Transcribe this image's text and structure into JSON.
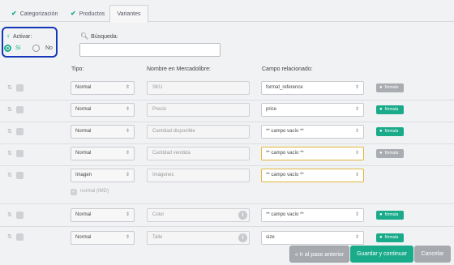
{
  "tabs": [
    {
      "label": "Categorización",
      "check": "✔"
    },
    {
      "label": "Productos",
      "check": "✔"
    },
    {
      "label": "Variantes"
    }
  ],
  "activar": {
    "label": "Activar:",
    "si": "Si",
    "no": "No",
    "selected": "Si"
  },
  "busqueda": {
    "label": "Búsqueda:",
    "value": ""
  },
  "columns": {
    "tipo": "Tipo:",
    "nombre": "Nombre en Mercadolibre:",
    "campo": "Campo relacionado:"
  },
  "rows": [
    {
      "tipo": "Normal",
      "nombre": "SKU",
      "campo": "format_reference",
      "formula": "fórmula",
      "formula_active": false
    },
    {
      "tipo": "Normal",
      "nombre": "Precio",
      "campo": "price",
      "formula": "fórmula",
      "formula_active": true
    },
    {
      "tipo": "Normal",
      "nombre": "Cantidad disponible",
      "campo": "** campo vacío **",
      "formula": "fórmula",
      "formula_active": true
    },
    {
      "tipo": "Normal",
      "nombre": "Cantidad vendida",
      "campo": "** campo vacío **",
      "formula": "fórmula",
      "formula_active": false
    },
    {
      "tipo": "Imagen",
      "nombre": "Imágenes",
      "campo": "** campo vacío **"
    },
    {
      "tipo": "Normal",
      "nombre": "Color",
      "campo": "** campo vacío **",
      "formula": "fórmula",
      "formula_active": true
    },
    {
      "tipo": "Normal",
      "nombre": "Talle",
      "campo": "size",
      "formula": "fórmula",
      "formula_active": true
    }
  ],
  "normal_imd": "normal (IMD)",
  "footer": {
    "prev": "« Ir al paso anterior",
    "next": "Guardar y continuar",
    "cancel": "Cancelar"
  },
  "colors": {
    "accent": "#1aab8b",
    "highlight_border": "#1436b8",
    "warning_border": "#e3b53d",
    "gray_button": "#a6a9ae"
  },
  "icons": {
    "tab_check": "check-icon",
    "activar": "lightbulb-icon",
    "busqueda": "search-icon",
    "row_drag": "drag-icon",
    "formula": "person-icon",
    "info": "info-icon"
  }
}
